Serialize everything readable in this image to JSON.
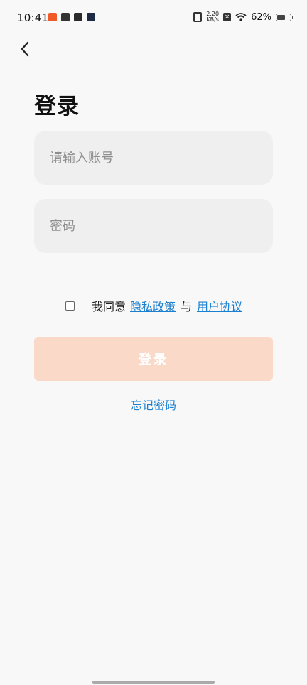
{
  "status_bar": {
    "time": "10:41",
    "net_speed_value": "2.20",
    "net_speed_unit": "KB/s",
    "battery_percent": "62%",
    "battery_level": 0.62
  },
  "page": {
    "title": "登录"
  },
  "form": {
    "account_placeholder": "请输入账号",
    "password_placeholder": "密码",
    "agree_prefix": "我同意",
    "privacy_link": "隐私政策",
    "and_text": "与",
    "terms_link": "用户协议",
    "login_label": "登录",
    "forgot_label": "忘记密码"
  },
  "colors": {
    "link": "#1a7fd0",
    "login_button_bg": "#fbd9c9",
    "input_bg": "#efefef"
  }
}
